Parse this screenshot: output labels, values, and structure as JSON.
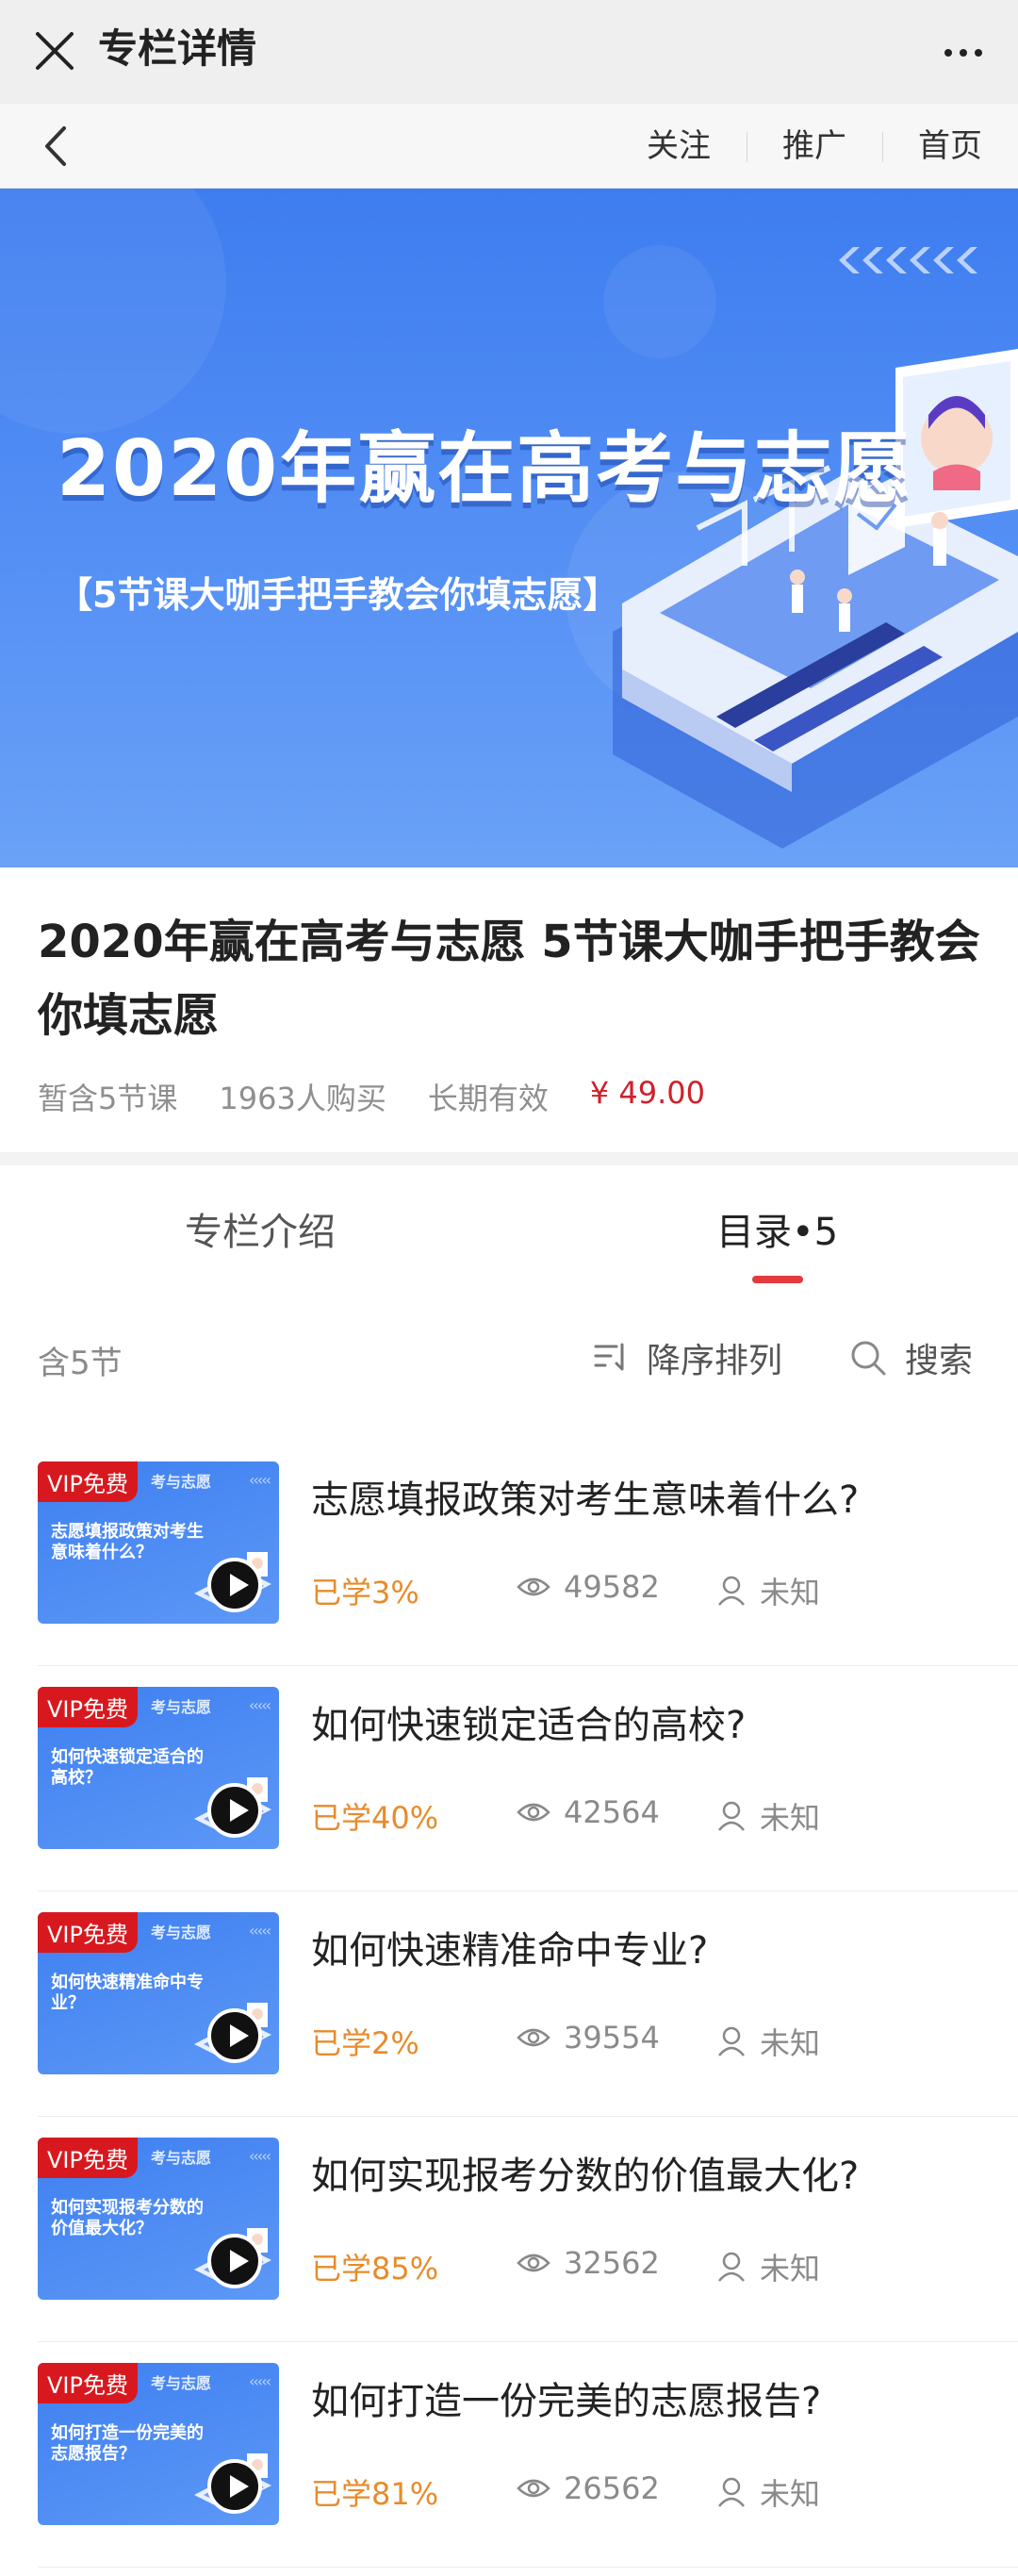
{
  "topbar": {
    "title": "专栏详情"
  },
  "nav": {
    "follow": "关注",
    "promote": "推广",
    "home": "首页"
  },
  "banner": {
    "title": "2020年赢在高考与志愿",
    "subtitle": "【5节课大咖手把手教会你填志愿】"
  },
  "course": {
    "title": "2020年赢在高考与志愿 5节课大咖手把手教会你填志愿",
    "lessons": "暂含5节课",
    "buyers": "1963人购买",
    "validity": "长期有效",
    "price": "¥ 49.00"
  },
  "tabs": {
    "intro": "专栏介绍",
    "catalog": "目录•5"
  },
  "filter": {
    "count": "含5节",
    "sort": "降序排列",
    "search": "搜索"
  },
  "colors": {
    "accent": "#e33b3b",
    "progress": "#e88b2b",
    "vip": "#d7191f"
  },
  "lessons": [
    {
      "badge": "VIP免费",
      "title": "志愿填报政策对考生意味着什么?",
      "progress": "已学3%",
      "views": "49582",
      "author": "未知"
    },
    {
      "badge": "VIP免费",
      "title": "如何快速锁定适合的高校?",
      "progress": "已学40%",
      "views": "42564",
      "author": "未知"
    },
    {
      "badge": "VIP免费",
      "title": "如何快速精准命中专业?",
      "progress": "已学2%",
      "views": "39554",
      "author": "未知"
    },
    {
      "badge": "VIP免费",
      "title": "如何实现报考分数的价值最大化?",
      "progress": "已学85%",
      "views": "32562",
      "author": "未知"
    },
    {
      "badge": "VIP免费",
      "title": "如何打造一份完美的志愿报告?",
      "progress": "已学81%",
      "views": "26562",
      "author": "未知"
    }
  ]
}
